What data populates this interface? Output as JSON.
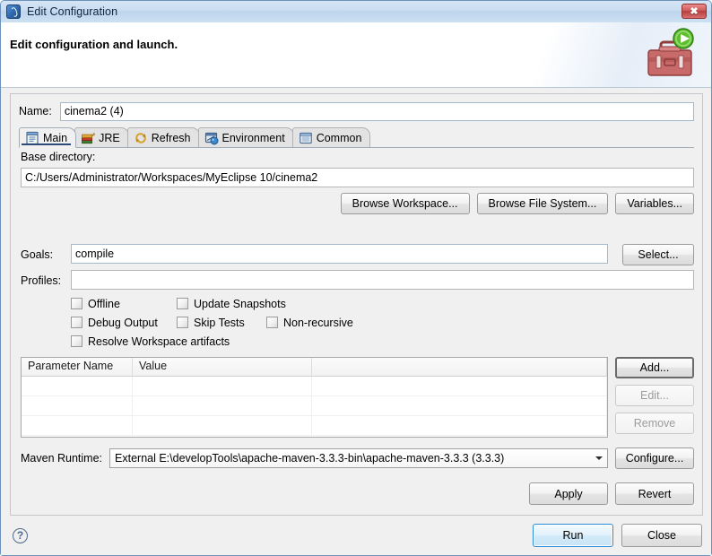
{
  "window": {
    "title": "Edit Configuration",
    "title_icon": "myeclipse-logo-icon",
    "close_label": "✖"
  },
  "banner": {
    "heading": "Edit configuration and launch.",
    "icon": "toolbox-with-run-icon"
  },
  "form": {
    "name_label": "Name:",
    "name_value": "cinema2 (4)"
  },
  "tabs": [
    {
      "label": "Main",
      "icon": "document-lines-icon",
      "active": true
    },
    {
      "label": "JRE",
      "icon": "books-jre-icon",
      "active": false
    },
    {
      "label": "Refresh",
      "icon": "refresh-arrows-icon",
      "active": false
    },
    {
      "label": "Environment",
      "icon": "environment-icon",
      "active": false
    },
    {
      "label": "Common",
      "icon": "common-list-icon",
      "active": false
    }
  ],
  "main_tab": {
    "base_directory_label": "Base directory:",
    "base_directory_value": "C:/Users/Administrator/Workspaces/MyEclipse 10/cinema2",
    "browse_workspace_label": "Browse Workspace...",
    "browse_filesystem_label": "Browse File System...",
    "variables_label": "Variables...",
    "goals_label": "Goals:",
    "goals_value": "compile",
    "goals_select_label": "Select...",
    "profiles_label": "Profiles:",
    "profiles_value": "",
    "checkboxes": [
      {
        "label": "Offline",
        "checked": false
      },
      {
        "label": "Update Snapshots",
        "checked": false
      },
      {
        "label": "Debug Output",
        "checked": false
      },
      {
        "label": "Skip Tests",
        "checked": false
      },
      {
        "label": "Non-recursive",
        "checked": false
      },
      {
        "label": "Resolve Workspace artifacts",
        "checked": false
      }
    ],
    "parameters_table": {
      "columns": [
        "Parameter Name",
        "Value",
        ""
      ],
      "rows": [
        [
          "",
          "",
          ""
        ],
        [
          "",
          "",
          ""
        ],
        [
          "",
          "",
          ""
        ]
      ]
    },
    "add_label": "Add...",
    "edit_label": "Edit...",
    "remove_label": "Remove",
    "maven_runtime_label": "Maven Runtime:",
    "maven_runtime_value": "External E:\\developTools\\apache-maven-3.3.3-bin\\apache-maven-3.3.3 (3.3.3)",
    "configure_label": "Configure...",
    "apply_label": "Apply",
    "revert_label": "Revert"
  },
  "footer": {
    "help_label": "?",
    "run_label": "Run",
    "close_label": "Close"
  },
  "colors": {
    "accent_blue": "#2a8cd6",
    "tab_underline": "#2c4b78",
    "window_frame": "#6d93bd",
    "close_red": "#b83c3c"
  }
}
